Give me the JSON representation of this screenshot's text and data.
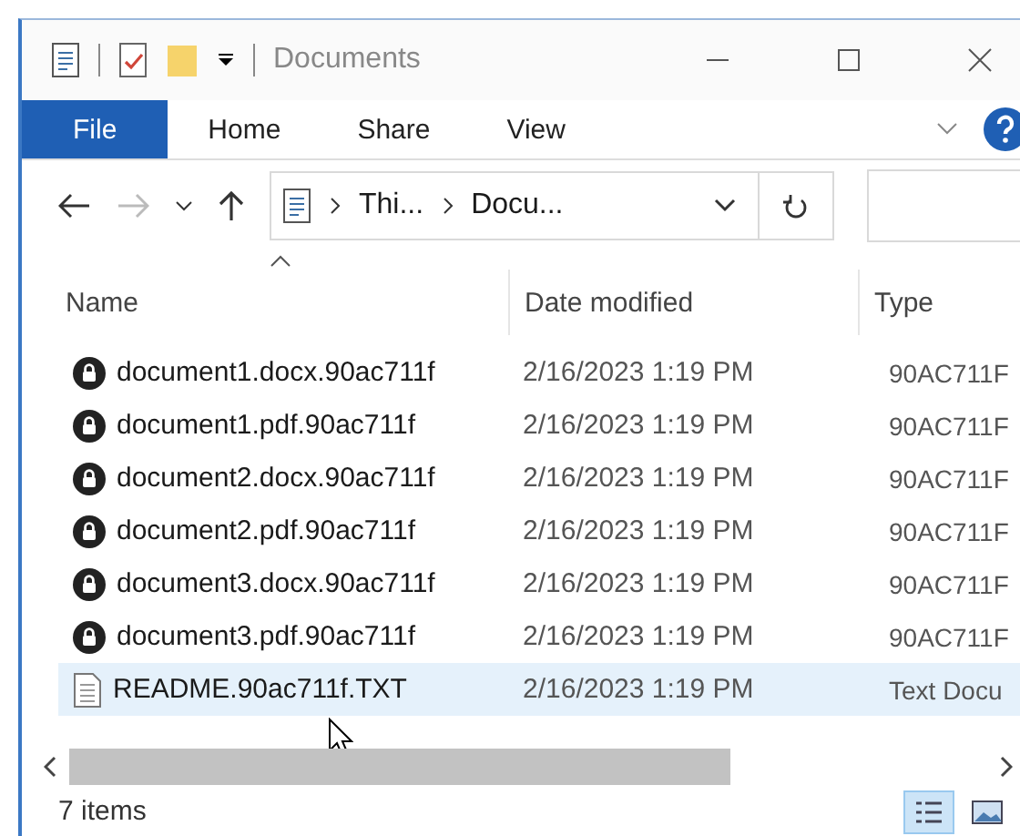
{
  "window": {
    "title": "Documents"
  },
  "ribbon_tabs": [
    {
      "label": "File",
      "selected": true
    },
    {
      "label": "Home",
      "selected": false
    },
    {
      "label": "Share",
      "selected": false
    },
    {
      "label": "View",
      "selected": false
    }
  ],
  "address": {
    "segments": [
      "Thi...",
      "Docu..."
    ]
  },
  "columns": [
    "Name",
    "Date modified",
    "Type"
  ],
  "rows": [
    {
      "kind": "locked",
      "name": "document1.docx.90ac711f",
      "date": "2/16/2023 1:19 PM",
      "type": "90AC711F",
      "selected": false
    },
    {
      "kind": "locked",
      "name": "document1.pdf.90ac711f",
      "date": "2/16/2023 1:19 PM",
      "type": "90AC711F",
      "selected": false
    },
    {
      "kind": "locked",
      "name": "document2.docx.90ac711f",
      "date": "2/16/2023 1:19 PM",
      "type": "90AC711F",
      "selected": false
    },
    {
      "kind": "locked",
      "name": "document2.pdf.90ac711f",
      "date": "2/16/2023 1:19 PM",
      "type": "90AC711F",
      "selected": false
    },
    {
      "kind": "locked",
      "name": "document3.docx.90ac711f",
      "date": "2/16/2023 1:19 PM",
      "type": "90AC711F",
      "selected": false
    },
    {
      "kind": "locked",
      "name": "document3.pdf.90ac711f",
      "date": "2/16/2023 1:19 PM",
      "type": "90AC711F",
      "selected": false
    },
    {
      "kind": "text",
      "name": "README.90ac711f.TXT",
      "date": "2/16/2023 1:19 PM",
      "type": "Text Docu",
      "selected": true
    }
  ],
  "status_bar": {
    "count": "7 items",
    "views": [
      {
        "kind": "details",
        "selected": true
      },
      {
        "kind": "thumbnails",
        "selected": false
      }
    ]
  }
}
